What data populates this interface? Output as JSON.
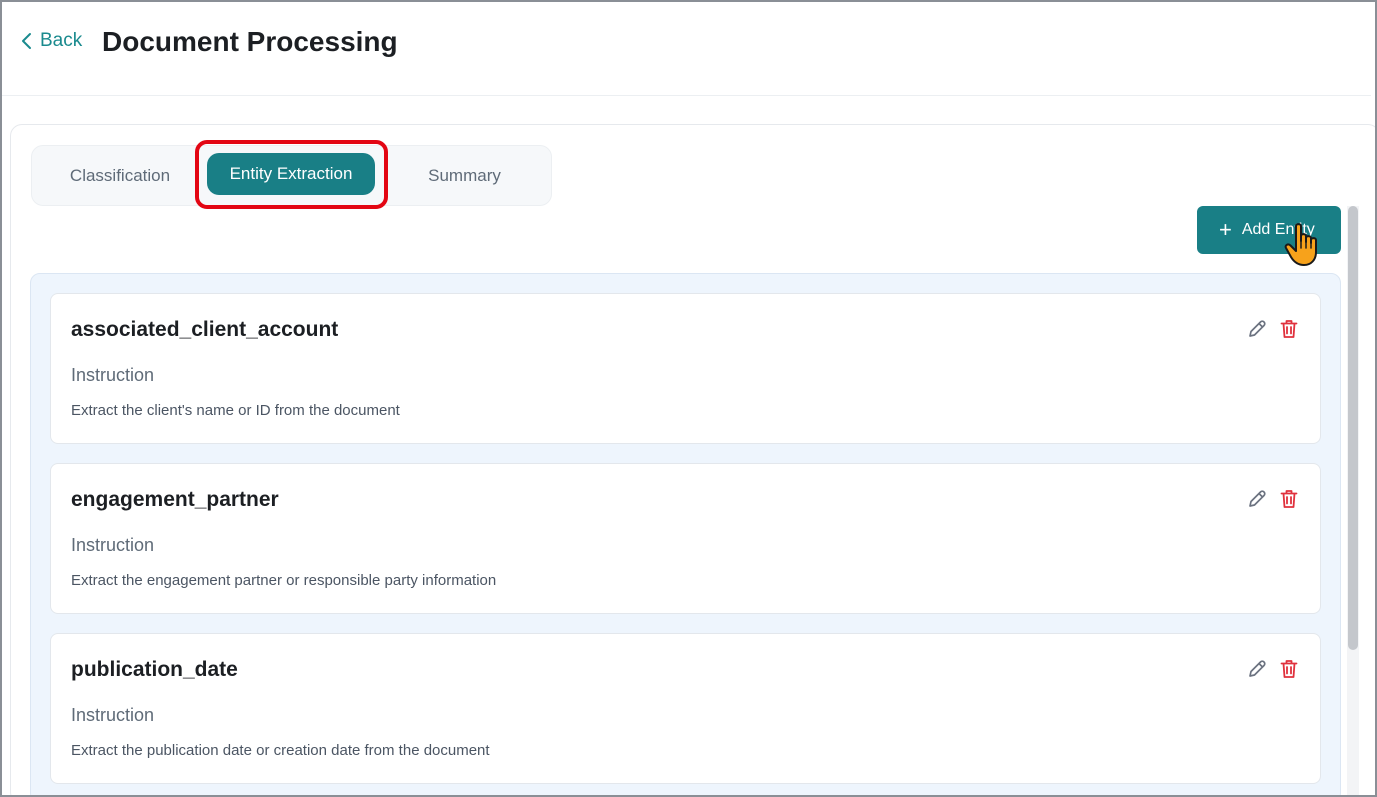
{
  "header": {
    "back_label": "Back",
    "title": "Document Processing"
  },
  "tabs": [
    {
      "label": "Classification",
      "active": false
    },
    {
      "label": "Entity Extraction",
      "active": true
    },
    {
      "label": "Summary",
      "active": false
    }
  ],
  "toolbar": {
    "add_label": "Add Entity"
  },
  "entities": [
    {
      "name": "associated_client_account",
      "instruction_label": "Instruction",
      "instruction": "Extract the client's name or ID from the document"
    },
    {
      "name": "engagement_partner",
      "instruction_label": "Instruction",
      "instruction": "Extract the engagement partner or responsible party information"
    },
    {
      "name": "publication_date",
      "instruction_label": "Instruction",
      "instruction": "Extract the publication date or creation date from the document"
    }
  ],
  "colors": {
    "accent": "#197f86",
    "delete": "#e0313d",
    "highlight": "#e30613"
  }
}
